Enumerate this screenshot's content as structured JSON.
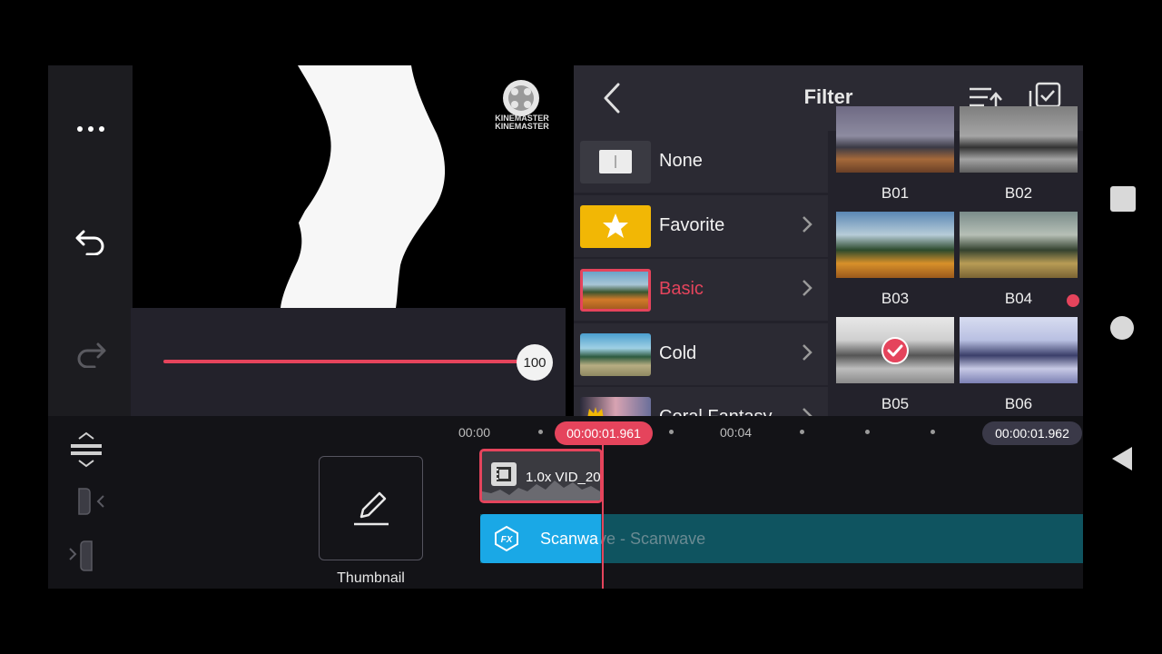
{
  "left_rail": {
    "icons": [
      "more-icon",
      "undo-icon",
      "redo-icon"
    ]
  },
  "preview": {
    "watermark": [
      "KINEMASTER",
      "KINEMASTER"
    ]
  },
  "slider": {
    "value_label": "100",
    "level": 1.0
  },
  "filter_panel": {
    "title": "Filter",
    "categories": [
      {
        "label": "None",
        "chevron": false
      },
      {
        "label": "Favorite",
        "chevron": true
      },
      {
        "label": "Basic",
        "chevron": true,
        "selected": true
      },
      {
        "label": "Cold",
        "chevron": true
      },
      {
        "label": "Coral Fantasy",
        "chevron": true
      }
    ],
    "filters": [
      {
        "label": "B01"
      },
      {
        "label": "B02"
      },
      {
        "label": "B03"
      },
      {
        "label": "B04"
      },
      {
        "label": "B05",
        "checked": true
      },
      {
        "label": "B06"
      }
    ]
  },
  "timeline": {
    "start_time": "00:00",
    "mid_time": "00:04",
    "playhead_time": "00:00:01.961",
    "end_time": "00:00:01.962",
    "thumbnail_label": "Thumbnail",
    "video_clip_label": "1.0x VID_20",
    "fx_clip_label": "Scanwave - Scanwave",
    "fx_clip_visible": "Scanwa"
  },
  "colors": {
    "accent": "#e5445c",
    "fx_blue": "#1aa8e6",
    "panel": "#23222b"
  }
}
